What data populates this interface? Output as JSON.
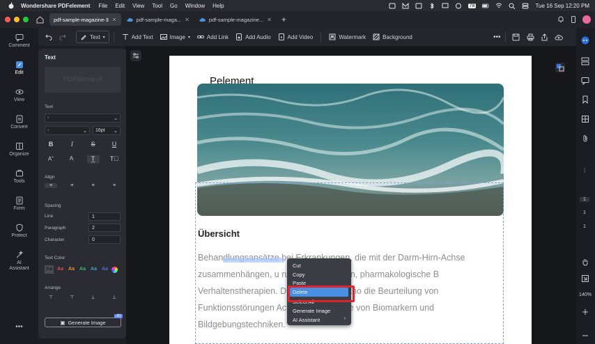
{
  "menubar": {
    "app_name": "Wondershare PDFelement",
    "menus": [
      "File",
      "Edit",
      "View",
      "Tool",
      "Go",
      "Window",
      "Help"
    ],
    "battery": "78",
    "clock": "Tue 16 Sep  12:20 PM"
  },
  "tabs": [
    {
      "label": "pdf-sample-magazine-3",
      "active": true
    },
    {
      "label": "pdf-sample-maga...",
      "active": false
    },
    {
      "label": "pdf-sample-magazine...",
      "active": false
    }
  ],
  "leftnav": [
    {
      "label": "Comment",
      "icon": "comment-icon"
    },
    {
      "label": "Edit",
      "icon": "edit-icon",
      "active": true
    },
    {
      "label": "View",
      "icon": "view-icon"
    },
    {
      "label": "Convert",
      "icon": "convert-icon"
    },
    {
      "label": "Organize",
      "icon": "organize-icon"
    },
    {
      "label": "Tools",
      "icon": "tools-icon"
    },
    {
      "label": "Form",
      "icon": "form-icon"
    },
    {
      "label": "Protect",
      "icon": "protect-icon"
    },
    {
      "label": "AI Assistant",
      "icon": "ai-assistant-icon"
    }
  ],
  "toolbar": {
    "text_mode": "Text",
    "add_text": "Add Text",
    "image": "Image",
    "add_link": "Add Link",
    "add_audio": "Add Audio",
    "add_video": "Add Video",
    "watermark": "Watermark",
    "background": "Background"
  },
  "panel": {
    "title": "Text",
    "preview": "PDFelement",
    "text_label": "Text",
    "font_value": "-",
    "style_value": "-",
    "size_value": "16pt",
    "align_label": "Align",
    "spacing_label": "Spacing",
    "line_label": "Line",
    "line_value": "1",
    "paragraph_label": "Paragraph",
    "paragraph_value": "2",
    "character_label": "Character",
    "character_value": "0",
    "textcolor_label": "Text Color",
    "color_sample": "Aa",
    "arrange_label": "Arrange",
    "generate_image": "Generate Image",
    "ai_badge": "AI"
  },
  "text_colors": [
    "#222222",
    "#e24b4b",
    "#f08a2a",
    "#3fb56a",
    "#3aa3c6",
    "#4a6fe0"
  ],
  "document": {
    "title": "Pelement",
    "heading": "Übersicht",
    "paragraph": "Behandlungsansätze bei Erkrankungen, die mit der Darm-Hirn-Achse zusammenhängen, u            rungsumstellungen, pharmakologische B            Verhaltenstherapien. Diagnostische Metho            die Beurteilung von Funktionsstörungen                Achse und die Rolle von Biomarkern und Bildgebungstechniken."
  },
  "context_menu": {
    "cut": "Cut",
    "copy": "Copy",
    "paste": "Paste",
    "delete": "Delete",
    "select_all": "Select All",
    "generate_image": "Generate Image",
    "ai_assistant": "AI Assistant"
  },
  "rightbar": {
    "page_current": "1",
    "page_total": "1",
    "page_num": "1",
    "zoom": "140%"
  }
}
